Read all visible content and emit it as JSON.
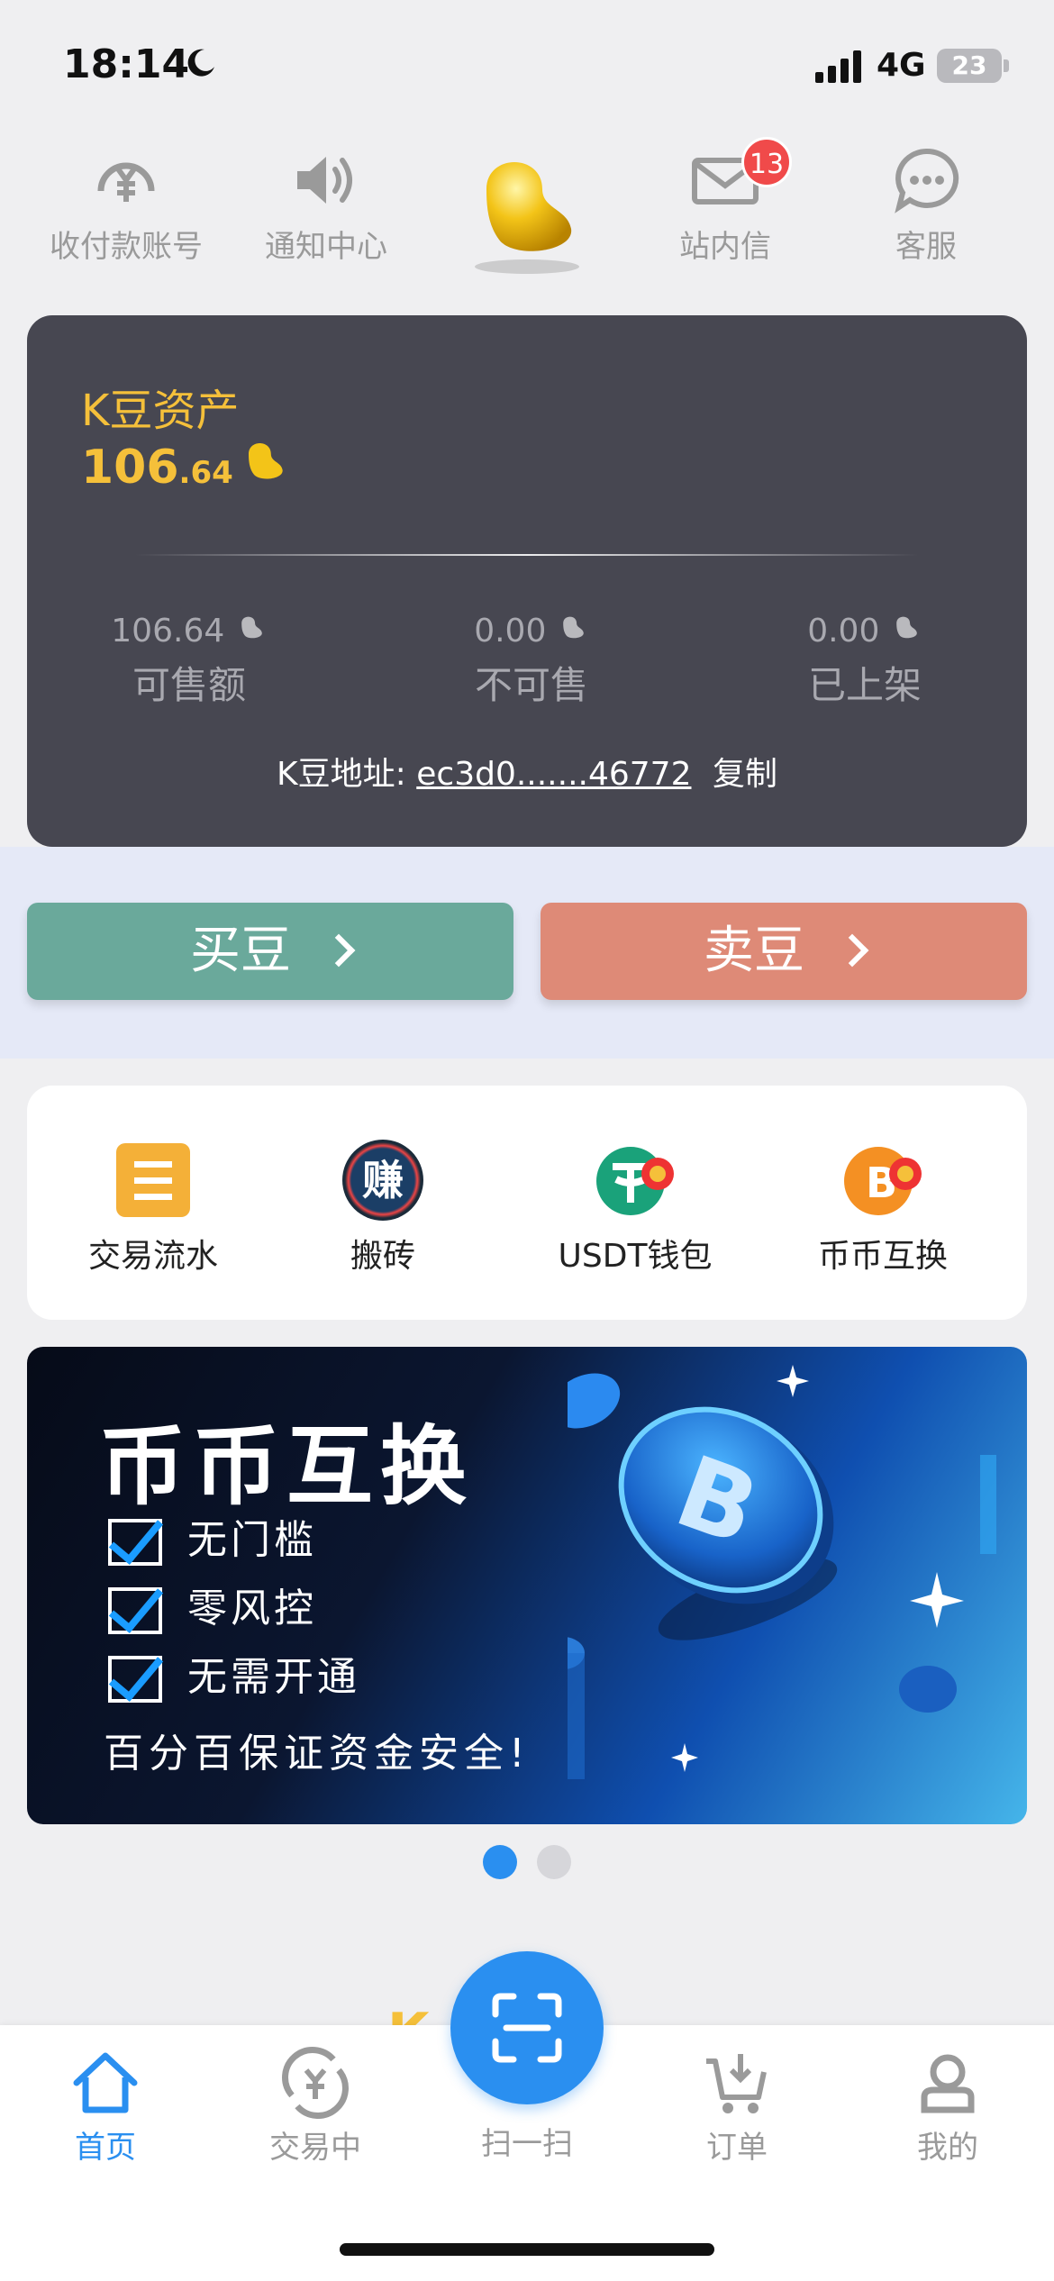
{
  "status": {
    "time": "18:14",
    "network": "4G",
    "battery": "23"
  },
  "top_nav": {
    "items": [
      {
        "label": "收付款账号",
        "icon": "yuan-circle-icon"
      },
      {
        "label": "通知中心",
        "icon": "speaker-icon"
      },
      {
        "label": "站内信",
        "icon": "mail-icon",
        "badge": "13"
      },
      {
        "label": "客服",
        "icon": "chat-bubble-icon"
      }
    ],
    "center_icon": "golden-bean-icon"
  },
  "asset": {
    "title": "K豆资产",
    "total_int": "106",
    "total_dec": ".64",
    "stats": [
      {
        "value": "106.64",
        "label": "可售额"
      },
      {
        "value": "0.00",
        "label": "不可售"
      },
      {
        "value": "0.00",
        "label": "已上架"
      }
    ],
    "address_label": "K豆地址:",
    "address_value": "ec3d0.......46772",
    "copy_label": "复制"
  },
  "actions": {
    "buy": "买豆",
    "sell": "卖豆"
  },
  "shortcuts": [
    {
      "label": "交易流水",
      "icon": "ledger-icon"
    },
    {
      "label": "搬砖",
      "icon": "earn-icon",
      "icon_text": "赚"
    },
    {
      "label": "USDT钱包",
      "icon": "usdt-icon"
    },
    {
      "label": "币币互换",
      "icon": "bitcoin-swap-icon"
    }
  ],
  "banner": {
    "title": "币币互换",
    "checks": [
      "无门槛",
      "零风控",
      "无需开通"
    ],
    "slogan": "百分百保证资金安全!"
  },
  "peek_text": "K",
  "tabs": [
    {
      "label": "首页",
      "icon": "home-icon",
      "active": true
    },
    {
      "label": "交易中",
      "icon": "trade-icon",
      "active": false
    },
    {
      "label": "扫一扫",
      "icon": "scan-icon",
      "active": false
    },
    {
      "label": "订单",
      "icon": "cart-icon",
      "active": false
    },
    {
      "label": "我的",
      "icon": "profile-icon",
      "active": false
    }
  ],
  "colors": {
    "accent": "#2a8ff0",
    "gold": "#f5c03a",
    "buy": "#6aa99b",
    "sell": "#de8a77",
    "card": "#474751"
  }
}
